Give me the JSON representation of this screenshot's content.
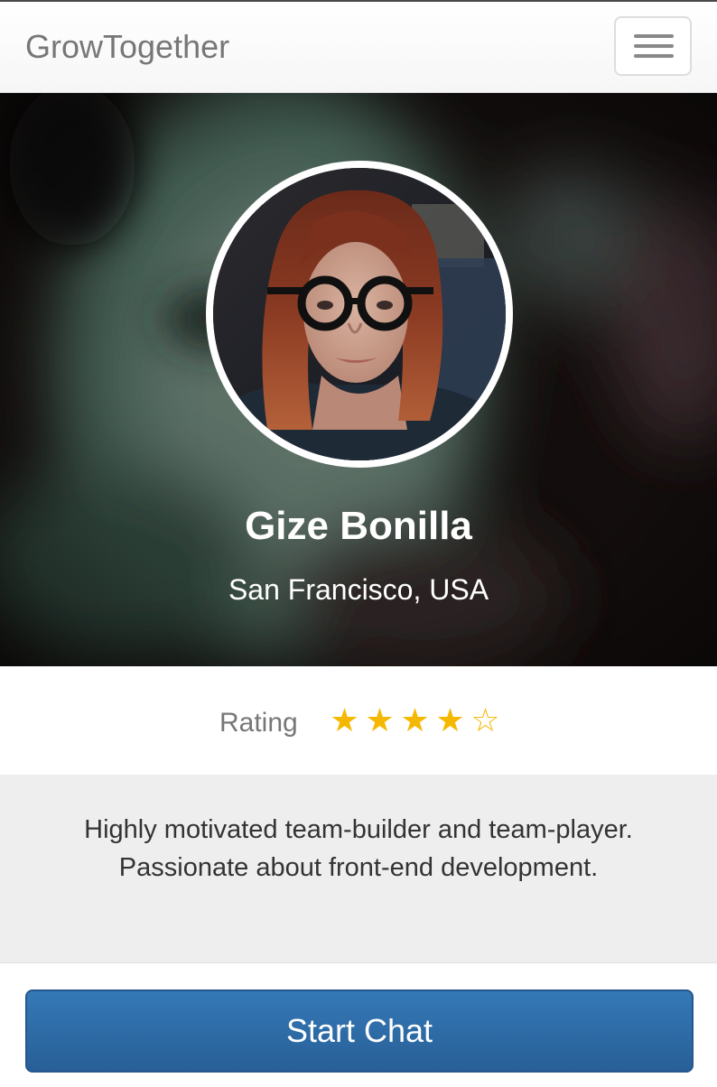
{
  "navbar": {
    "brand": "GrowTogether",
    "menu_icon": "hamburger-menu-icon"
  },
  "profile": {
    "name": "Gize Bonilla",
    "location": "San Francisco, USA",
    "avatar_alt": "profile photo"
  },
  "rating": {
    "label": "Rating",
    "value": 4,
    "max": 5,
    "stars": [
      "★",
      "★",
      "★",
      "★",
      "☆"
    ],
    "star_color": "#f5b800"
  },
  "bio": {
    "text": "Highly motivated team-builder and team-player. Passionate about front-end development."
  },
  "actions": {
    "start_chat_label": "Start Chat"
  },
  "colors": {
    "accent": "#3479b7",
    "bio_background": "#eeeeee"
  }
}
